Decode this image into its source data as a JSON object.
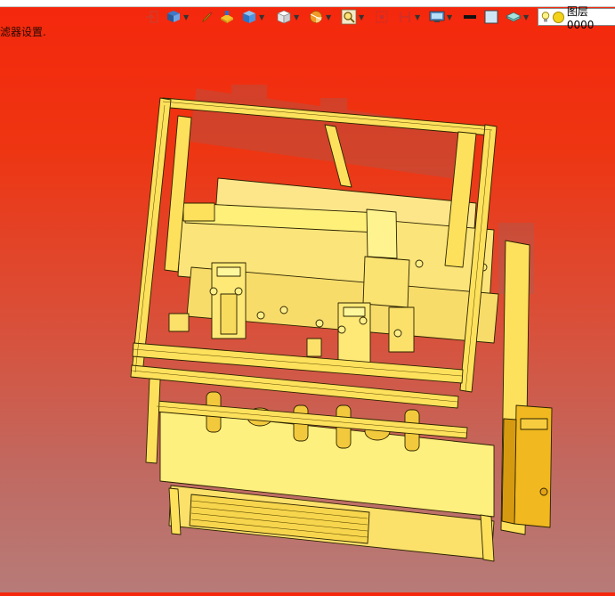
{
  "window": {
    "title": ""
  },
  "status": {
    "hint_text": "滤器设置."
  },
  "toolbar": {
    "items": [
      {
        "name": "exit-icon"
      },
      {
        "name": "view-icon",
        "dropdown": true
      },
      {
        "name": "pen-icon"
      },
      {
        "name": "paint-icon"
      },
      {
        "name": "box-icon",
        "dropdown": true
      },
      {
        "name": "cube-icon",
        "dropdown": true
      },
      {
        "name": "section-icon",
        "dropdown": true
      },
      {
        "name": "zoom-icon",
        "dropdown": true
      },
      {
        "name": "snap-icon"
      },
      {
        "name": "distance-icon",
        "dropdown": true
      },
      {
        "name": "display-icon",
        "dropdown": true
      },
      {
        "name": "line-icon"
      },
      {
        "name": "color-icon"
      },
      {
        "name": "layer-visibility-icon",
        "dropdown": true
      }
    ],
    "layer": {
      "label": "图层0000"
    }
  },
  "colors": {
    "background_top": "#f5270c",
    "background_bottom": "#b77b78",
    "model_fill": "#fde96b",
    "model_edge": "#2b2200"
  },
  "viewport": {
    "model": "3D machine frame assembly"
  }
}
